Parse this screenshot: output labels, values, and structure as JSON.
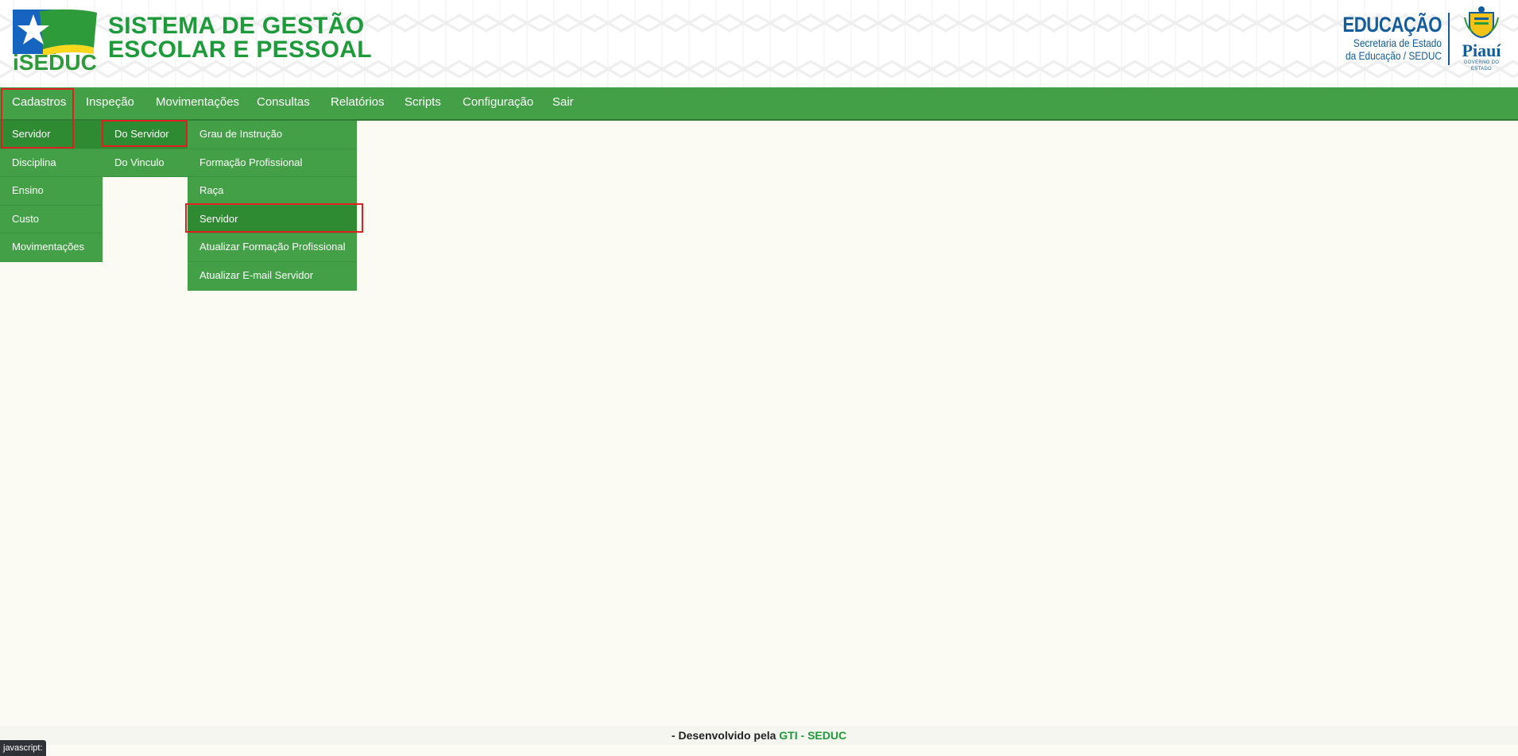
{
  "header": {
    "logo_text": "iSEDUC",
    "title_line1": "SISTEMA DE GESTÃO",
    "title_line2": "ESCOLAR E PESSOAL",
    "edu_title": "EDUCAÇÃO",
    "edu_sub1": "Secretaria de Estado",
    "edu_sub2": "da Educação / SEDUC",
    "state_name": "Piauí",
    "state_gov": "GOVERNO DO ESTADO"
  },
  "menu": {
    "items": [
      "Cadastros",
      "Inspeção",
      "Movimentações",
      "Consultas",
      "Relatórios",
      "Scripts",
      "Configuração",
      "Sair"
    ]
  },
  "cadastros_menu": {
    "items": [
      "Servidor",
      "Disciplina",
      "Ensino",
      "Custo",
      "Movimentações"
    ]
  },
  "servidor_menu": {
    "items": [
      "Do Servidor",
      "Do Vinculo"
    ]
  },
  "do_servidor_menu": {
    "items": [
      "Grau de Instrução",
      "Formação Profissional",
      "Raça",
      "Servidor",
      "Atualizar Formação Profissional",
      "Atualizar E-mail Servidor"
    ]
  },
  "footer": {
    "prefix": "- Desenvolvido pela ",
    "brand": "GTI - SEDUC"
  },
  "status_bar": {
    "text": "javascript:"
  },
  "colors": {
    "menu_green": "#43a047",
    "active_green": "#2e8b32",
    "title_green": "#1d9b3a",
    "edu_blue": "#135d9c",
    "highlight_red": "#e02020"
  }
}
